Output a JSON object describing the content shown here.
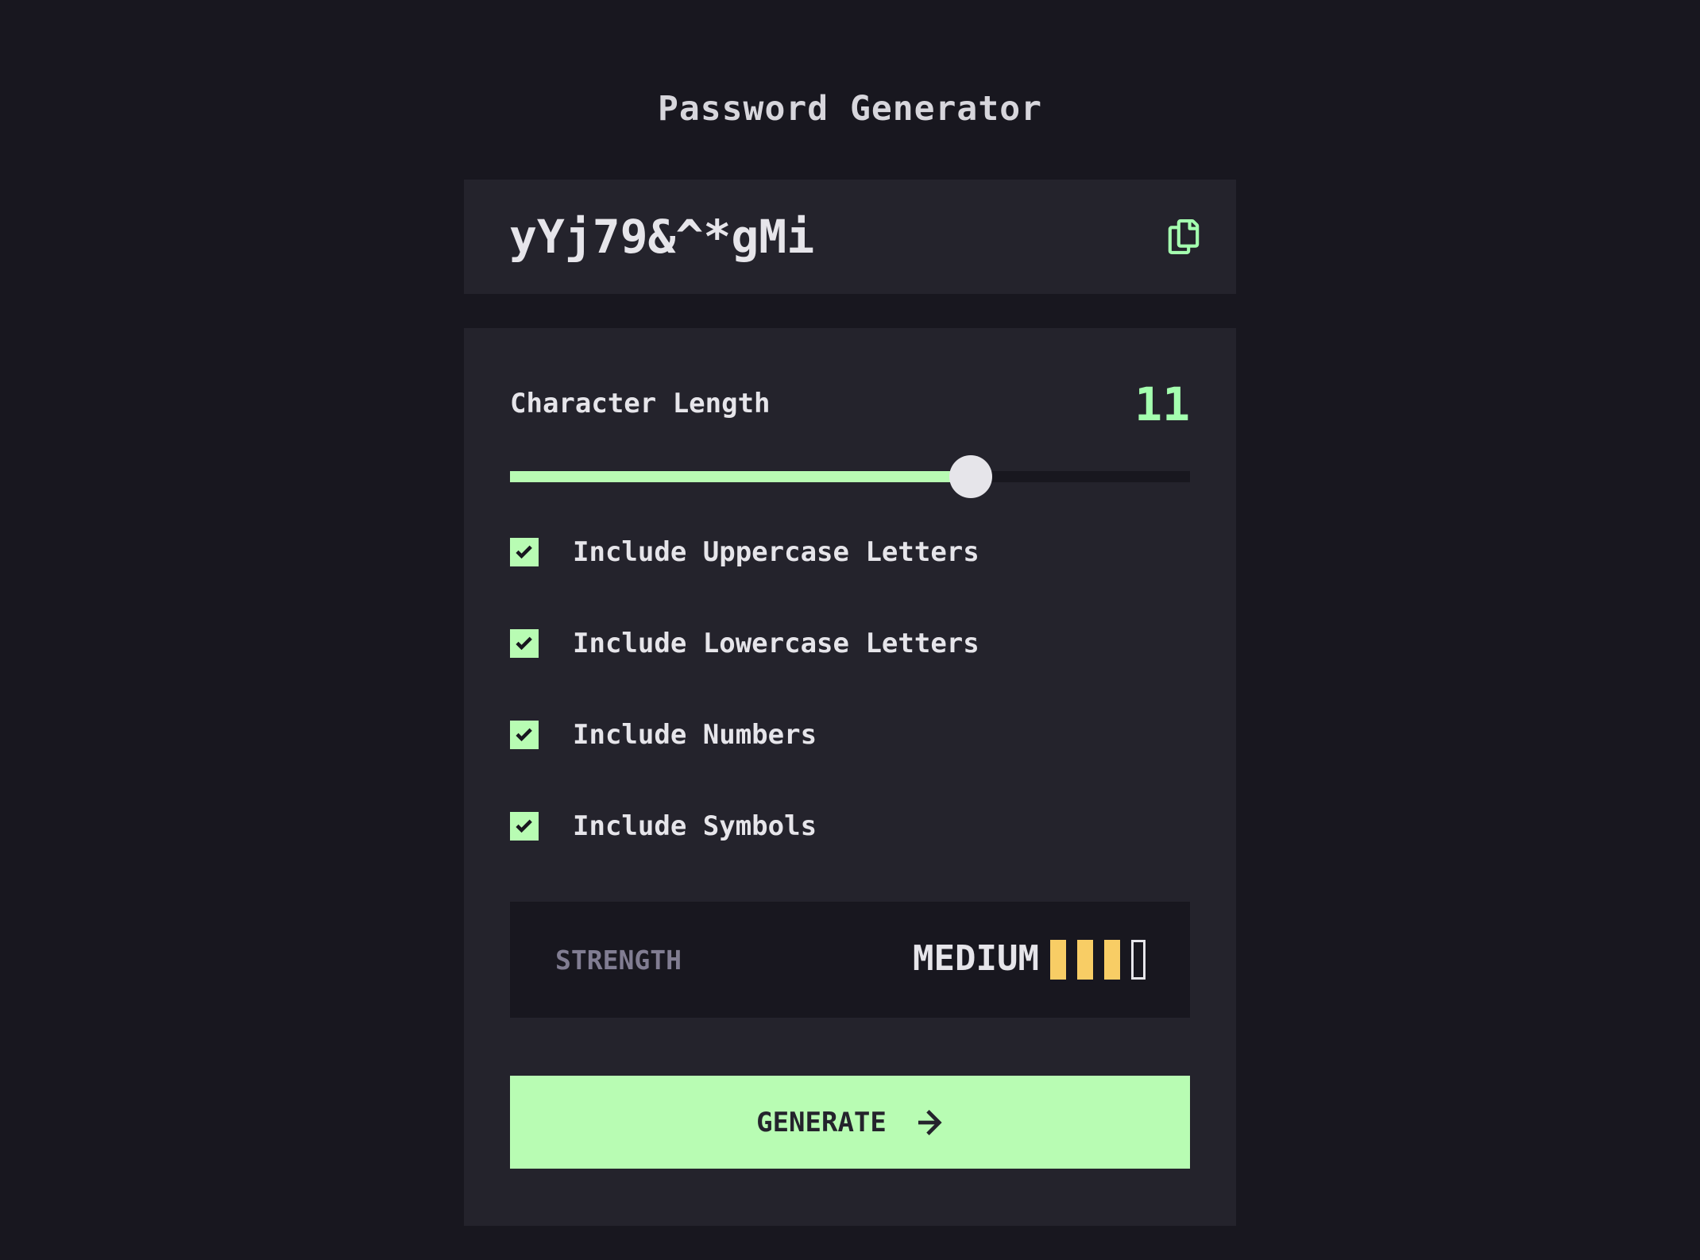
{
  "app": {
    "title": "Password Generator"
  },
  "password": {
    "value": "yYj79&^*gMi",
    "copy_icon": "copy-icon"
  },
  "length": {
    "label": "Character Length",
    "value": "11",
    "slider_fraction": 0.677
  },
  "options": [
    {
      "label": "Include Uppercase Letters",
      "checked": true
    },
    {
      "label": "Include Lowercase Letters",
      "checked": true
    },
    {
      "label": "Include Numbers",
      "checked": true
    },
    {
      "label": "Include Symbols",
      "checked": true
    }
  ],
  "strength": {
    "label": "STRENGTH",
    "level": "MEDIUM",
    "bars_filled": 3,
    "bars_total": 4,
    "color": "#f8cd65"
  },
  "generate": {
    "label": "GENERATE",
    "icon": "arrow-right-icon"
  },
  "colors": {
    "accent": "#a4ffaf",
    "button": "#b8fcb3",
    "background": "#18171f",
    "panel": "#24232c"
  }
}
